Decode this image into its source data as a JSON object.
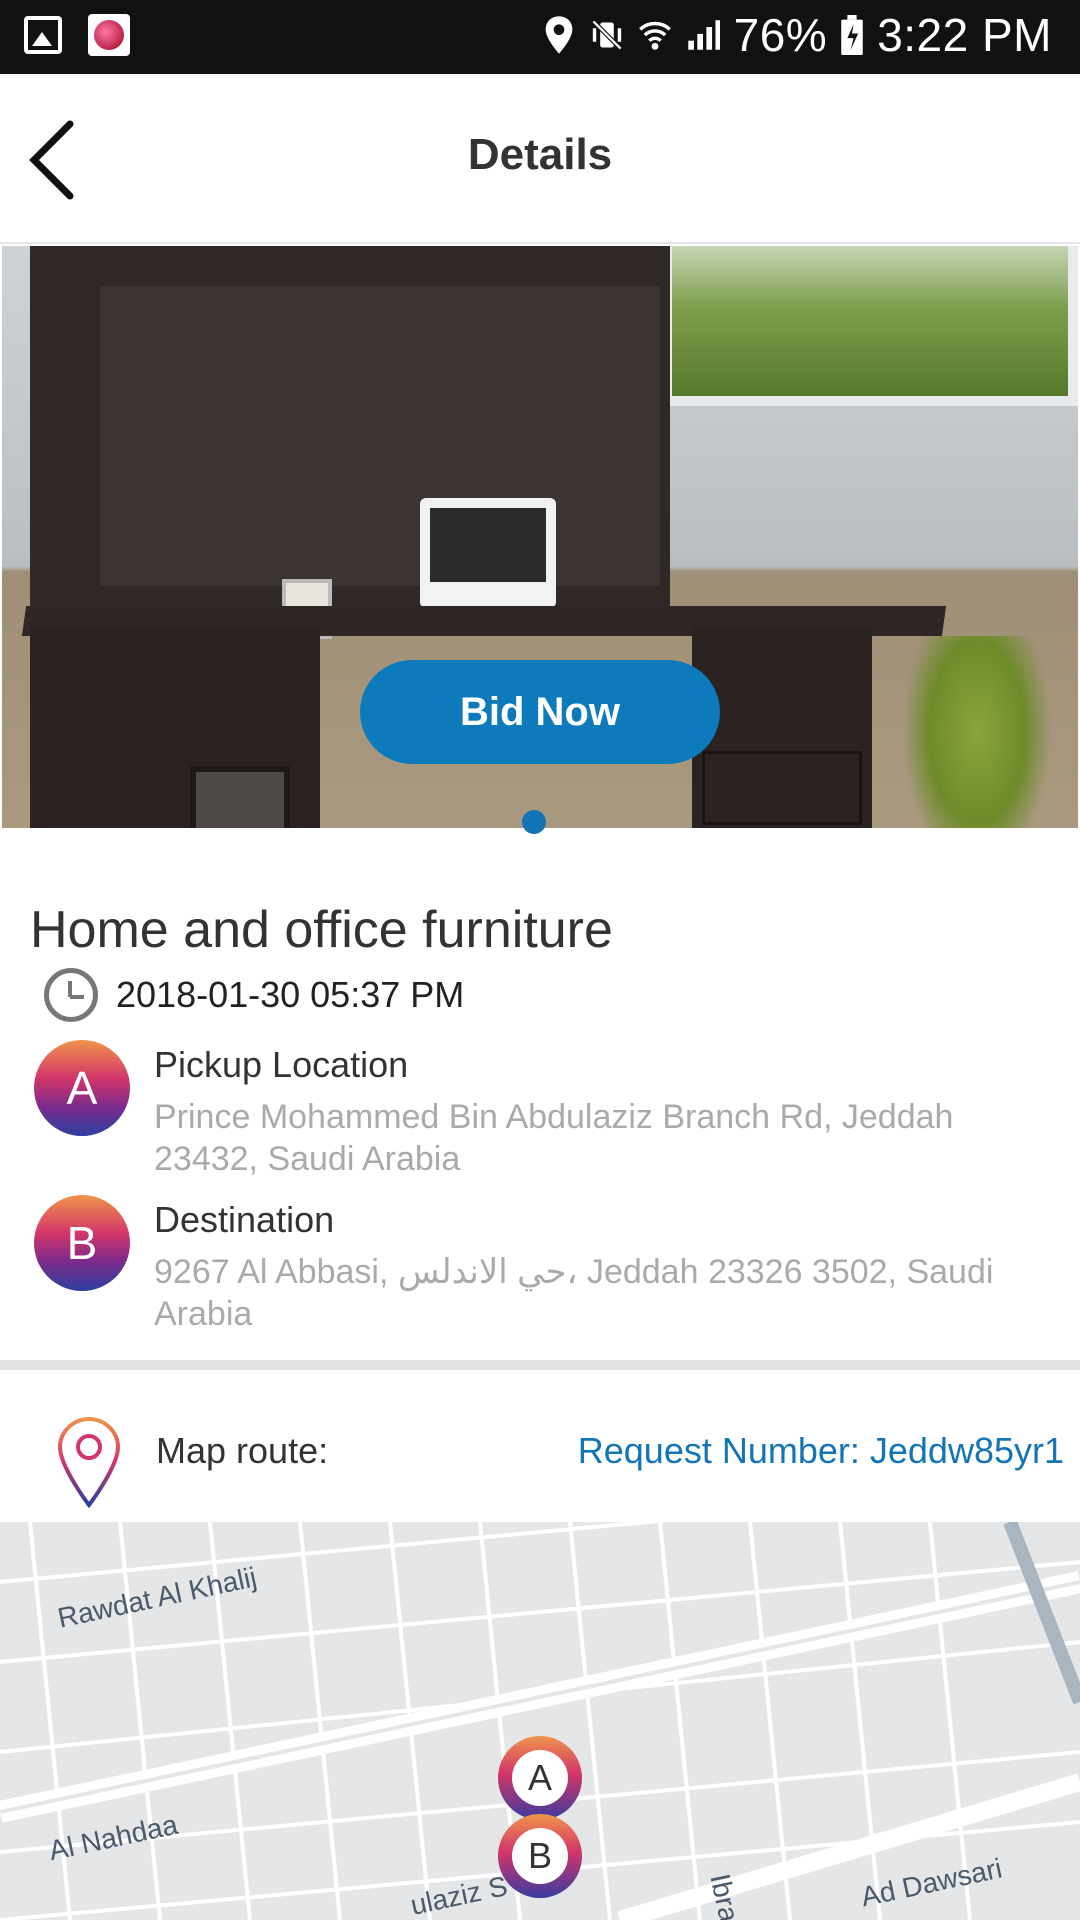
{
  "status_bar": {
    "battery": "76%",
    "time": "3:22 PM"
  },
  "header": {
    "title": "Details"
  },
  "hero": {
    "bid_label": "Bid Now"
  },
  "item": {
    "title": "Home and office furniture",
    "datetime": "2018-01-30 05:37 PM"
  },
  "pickup": {
    "badge": "A",
    "label": "Pickup Location",
    "address": "Prince Mohammed Bin Abdulaziz Branch Rd, Jeddah 23432, Saudi Arabia"
  },
  "destination": {
    "badge": "B",
    "label": "Destination",
    "address": "9267 Al Abbasi, حي الاندلس، Jeddah 23326 3502, Saudi Arabia"
  },
  "route": {
    "label": "Map route:",
    "request_number": "Request Number: Jeddw85yr1"
  },
  "map": {
    "roads": [
      "Rawdat Al Khalij",
      "Al Nahdaa",
      "Ad Dawsari",
      "ulaziz S",
      "Ibra"
    ],
    "pin_a": "A",
    "pin_b": "B"
  }
}
